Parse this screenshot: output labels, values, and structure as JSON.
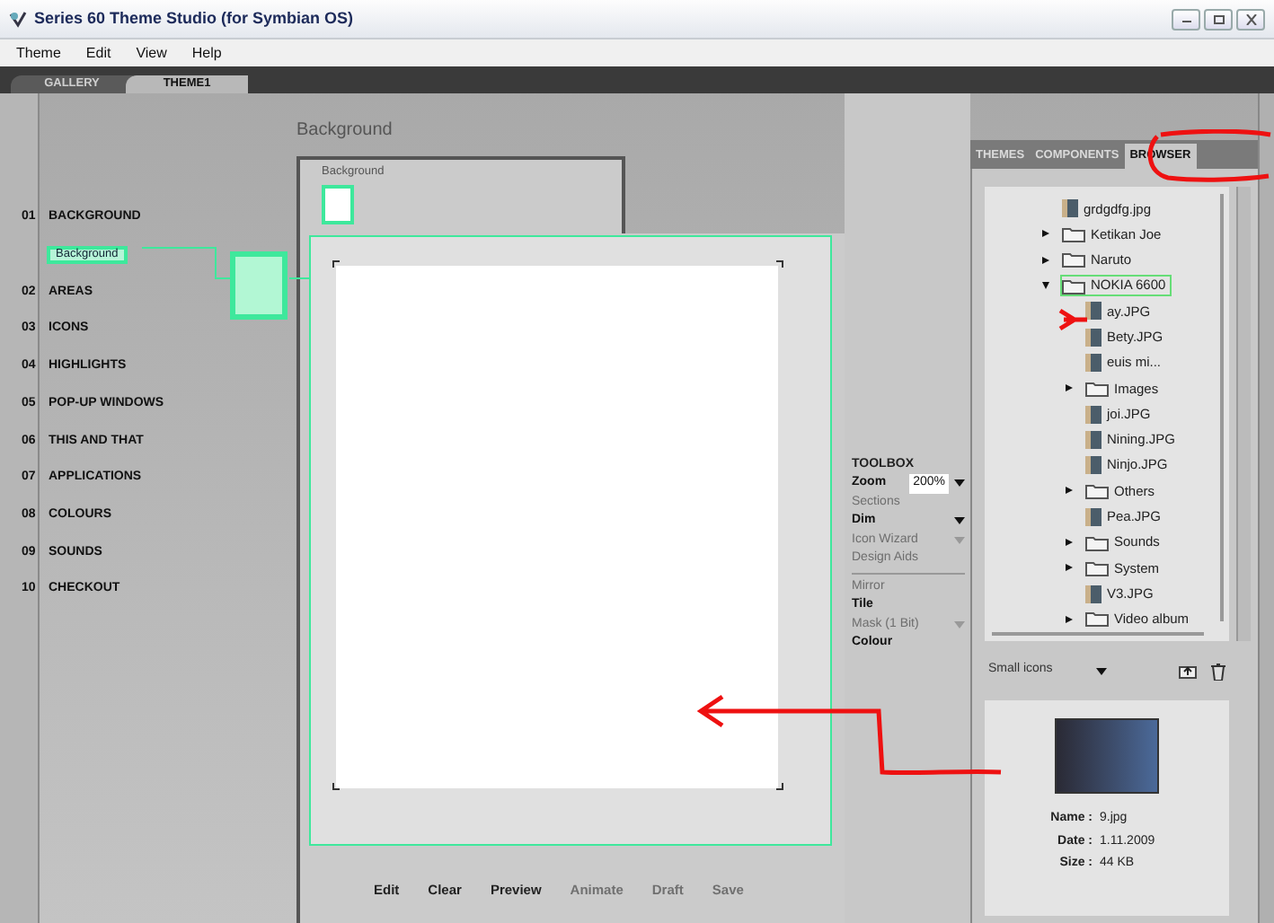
{
  "window": {
    "title": "Series 60 Theme Studio (for Symbian OS)"
  },
  "menu": [
    "Theme",
    "Edit",
    "View",
    "Help"
  ],
  "tabs": [
    {
      "label": "GALLERY",
      "selected": false
    },
    {
      "label": "THEME1",
      "selected": true
    }
  ],
  "nav": {
    "items": [
      {
        "number": "01",
        "label": "BACKGROUND",
        "subitems": [
          {
            "label": "Background",
            "selected": true
          }
        ]
      },
      {
        "number": "02",
        "label": "AREAS"
      },
      {
        "number": "03",
        "label": "ICONS"
      },
      {
        "number": "04",
        "label": "HIGHLIGHTS"
      },
      {
        "number": "05",
        "label": "POP-UP WINDOWS"
      },
      {
        "number": "06",
        "label": "THIS AND THAT"
      },
      {
        "number": "07",
        "label": "APPLICATIONS"
      },
      {
        "number": "08",
        "label": "COLOURS"
      },
      {
        "number": "09",
        "label": "SOUNDS"
      },
      {
        "number": "10",
        "label": "CHECKOUT"
      }
    ]
  },
  "editor": {
    "title": "Background",
    "element_label": "Background",
    "buttons": [
      {
        "label": "Edit",
        "disabled": false
      },
      {
        "label": "Clear",
        "disabled": false
      },
      {
        "label": "Preview",
        "disabled": false
      },
      {
        "label": "Animate",
        "disabled": true
      },
      {
        "label": "Draft",
        "disabled": true
      },
      {
        "label": "Save",
        "disabled": true
      }
    ]
  },
  "toolbox": {
    "title": "TOOLBOX",
    "items": [
      {
        "kind": "dropdown",
        "label": "Zoom",
        "value": "200%",
        "disabled": false
      },
      {
        "kind": "option",
        "label": "Sections",
        "disabled": true
      },
      {
        "kind": "dropdown",
        "label": "Dim",
        "disabled": false
      },
      {
        "kind": "dropdown",
        "label": "Icon Wizard",
        "disabled": true
      },
      {
        "kind": "option",
        "label": "Design Aids",
        "disabled": true
      },
      {
        "kind": "divider"
      },
      {
        "kind": "option",
        "label": "Mirror",
        "disabled": true
      },
      {
        "kind": "option",
        "label": "Tile",
        "disabled": false
      },
      {
        "kind": "dropdown",
        "label": "Mask (1 Bit)",
        "disabled": true
      },
      {
        "kind": "option",
        "label": "Colour",
        "disabled": false
      }
    ]
  },
  "browser": {
    "tabs": [
      {
        "label": "THEMES",
        "selected": false
      },
      {
        "label": "COMPONENTS",
        "selected": false
      },
      {
        "label": "BROWSER",
        "selected": true
      }
    ],
    "tree": [
      {
        "kind": "file",
        "label": "grdgdfg.jpg",
        "selected": false
      },
      {
        "kind": "folder",
        "label": "Ketikan Joe",
        "expanded": false,
        "selected": false
      },
      {
        "kind": "folder",
        "label": "Naruto",
        "expanded": false,
        "selected": false
      },
      {
        "kind": "folder",
        "label": "NOKIA 6600",
        "expanded": true,
        "selected": true,
        "children": [
          {
            "kind": "file",
            "label": "ay.JPG",
            "selected": false
          },
          {
            "kind": "file",
            "label": "Bety.JPG",
            "selected": false
          },
          {
            "kind": "file",
            "label": "euis mi...",
            "selected": false
          },
          {
            "kind": "folder",
            "label": "Images",
            "expanded": false,
            "selected": false
          },
          {
            "kind": "file",
            "label": "joi.JPG",
            "selected": false
          },
          {
            "kind": "file",
            "label": "Nining.JPG",
            "selected": false
          },
          {
            "kind": "file",
            "label": "Ninjo.JPG",
            "selected": false
          },
          {
            "kind": "folder",
            "label": "Others",
            "expanded": false,
            "selected": false
          },
          {
            "kind": "file",
            "label": "Pea.JPG",
            "selected": false
          },
          {
            "kind": "folder",
            "label": "Sounds",
            "expanded": false,
            "selected": false
          },
          {
            "kind": "folder",
            "label": "System",
            "expanded": false,
            "selected": false
          },
          {
            "kind": "file",
            "label": "V3.JPG",
            "selected": false
          },
          {
            "kind": "folder",
            "label": "Video album",
            "expanded": false,
            "selected": false
          }
        ]
      }
    ],
    "view_mode": "Small icons",
    "info": [
      {
        "label": "Name :",
        "value": "9.jpg"
      },
      {
        "label": "Date :",
        "value": "1.11.2009"
      },
      {
        "label": "Size :",
        "value": "44 KB"
      }
    ]
  }
}
